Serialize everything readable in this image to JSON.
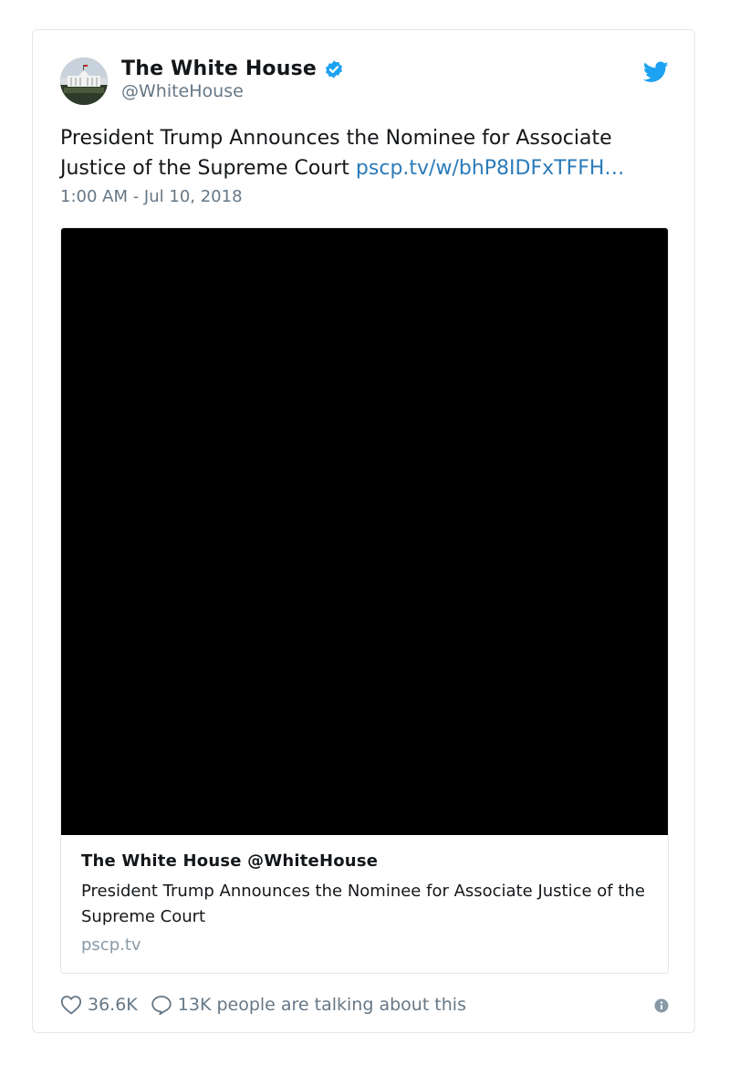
{
  "author": {
    "name": "The White House",
    "handle": "@WhiteHouse",
    "verified": true
  },
  "tweet": {
    "text": "President Trump Announces the Nominee for Associate Justice of the Supreme Court ",
    "link_text": "pscp.tv/w/bhP8IDFxTFFH…",
    "timestamp": "1:00 AM - Jul 10, 2018"
  },
  "card": {
    "title": "The White House @WhiteHouse",
    "description": "President Trump Announces the Nominee for Associate Justice of the Supreme Court",
    "domain": "pscp.tv"
  },
  "footer": {
    "likes": "36.6K",
    "replies": "13K people are talking about this"
  },
  "icons": {
    "brand": "twitter-bird-icon",
    "verified": "verified-badge-icon",
    "like": "heart-icon",
    "reply": "speech-bubble-icon",
    "info": "info-icon"
  },
  "colors": {
    "link": "#2b7bb9",
    "twitter_blue": "#1da1f2",
    "muted": "#657786",
    "text": "#14171a",
    "video_bg": "#000000"
  }
}
